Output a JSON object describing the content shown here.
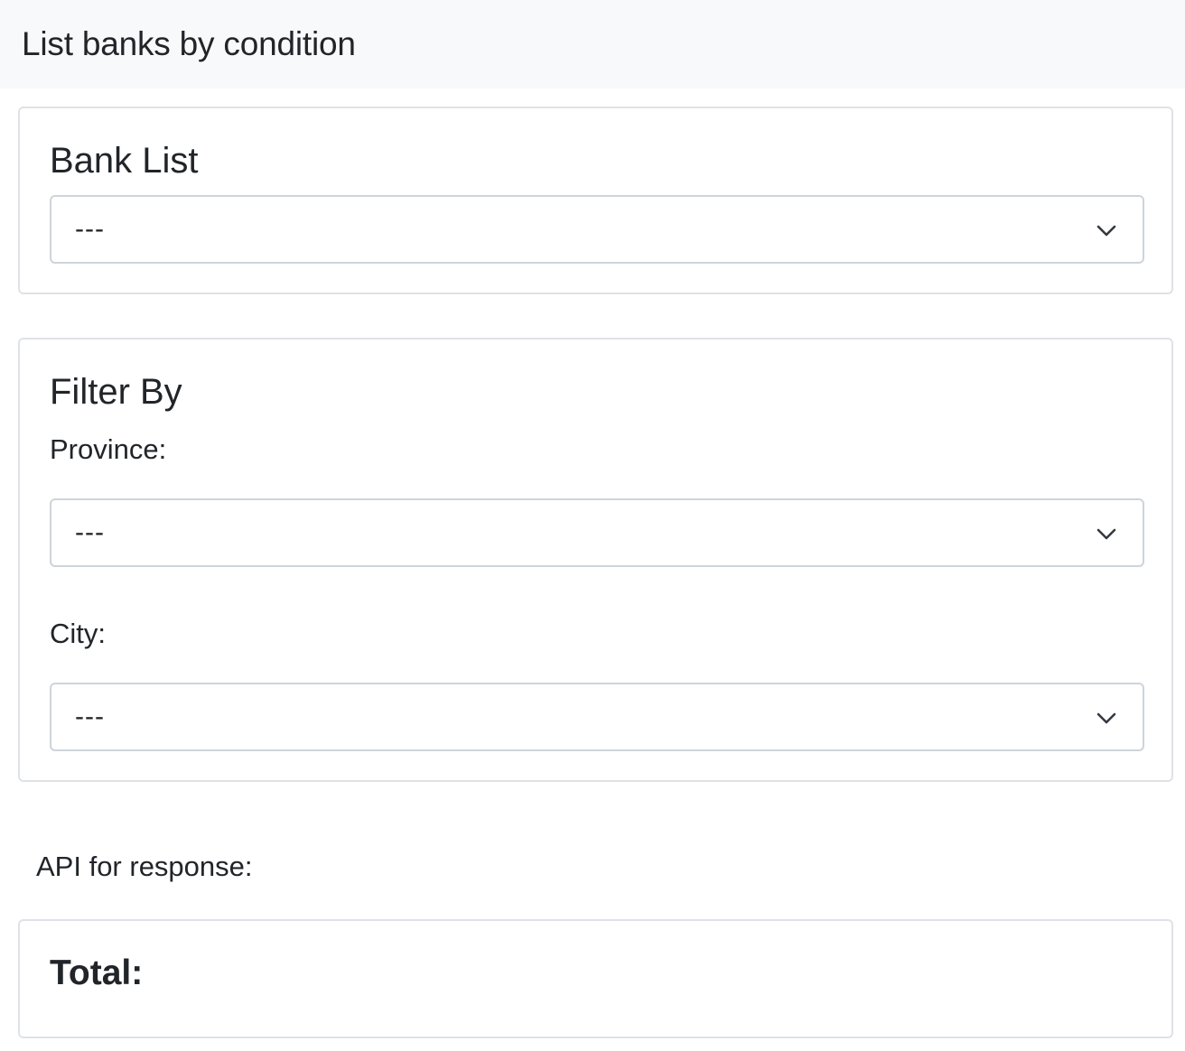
{
  "header": {
    "title": "List banks by condition"
  },
  "bank_card": {
    "title": "Bank List",
    "select_value": "---",
    "chevron_icon": "chevron-down-icon"
  },
  "filter_card": {
    "title": "Filter By",
    "province_label": "Province:",
    "province_value": "---",
    "city_label": "City:",
    "city_value": "---"
  },
  "api_label": "API for response:",
  "total_card": {
    "title": "Total:"
  },
  "colors": {
    "header_bg": "#f8f9fa",
    "text": "#212529",
    "border": "#dfe2e6",
    "select_border": "#ced4da"
  }
}
